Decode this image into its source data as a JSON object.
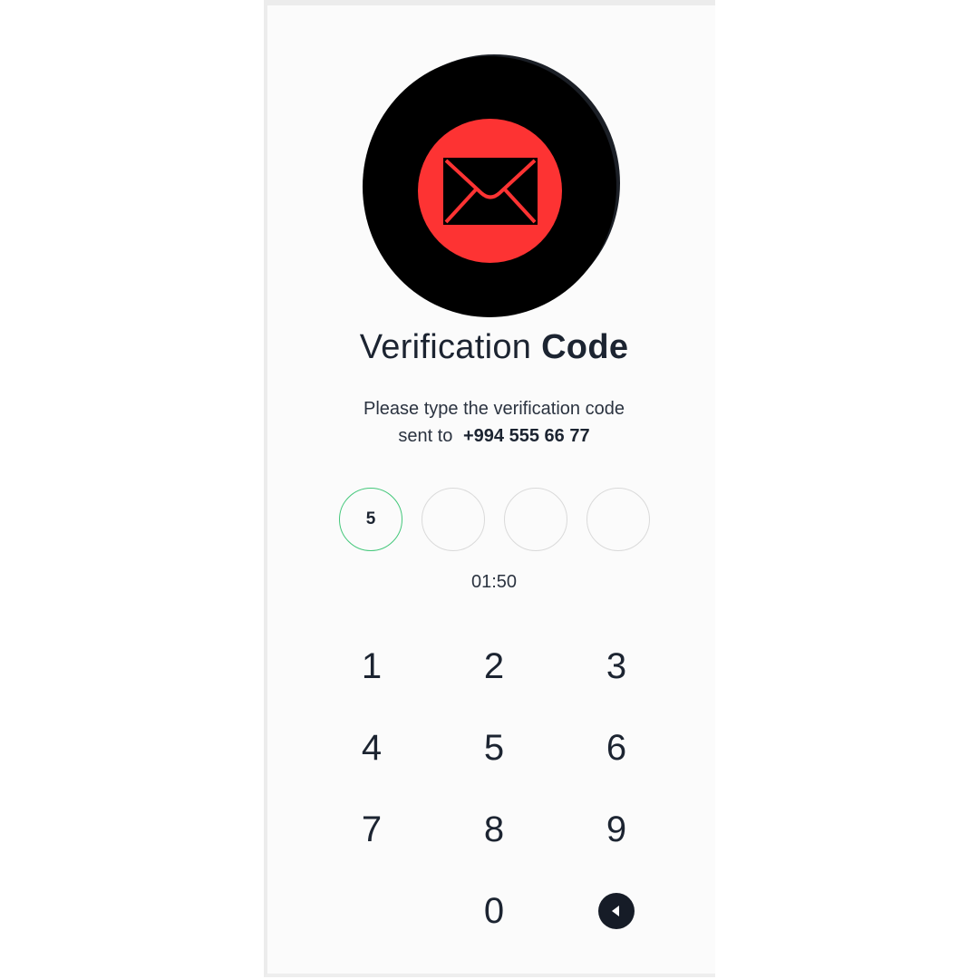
{
  "header": {
    "title_regular": "Verification",
    "title_bold": "Code",
    "instruction_line1": "Please type the verification code",
    "instruction_line2": "sent to",
    "phone_number": "+994 555 66 77"
  },
  "icons": {
    "avatar": "envelope-icon",
    "backspace": "backspace-icon"
  },
  "colors": {
    "avatar_bg": "#000000",
    "avatar_accent": "#fd3333",
    "active_digit_border": "#43c77a",
    "text": "#1c2431"
  },
  "code": {
    "digits": [
      "5",
      "",
      "",
      ""
    ],
    "active_index": 0
  },
  "timer": "01:50",
  "keypad": {
    "keys": [
      "1",
      "2",
      "3",
      "4",
      "5",
      "6",
      "7",
      "8",
      "9",
      "0"
    ]
  }
}
